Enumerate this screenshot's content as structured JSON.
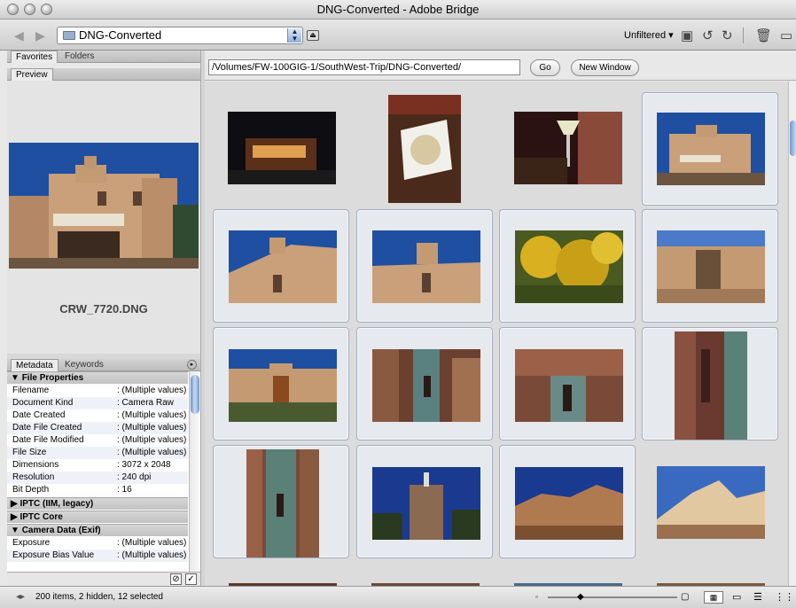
{
  "window": {
    "title": "DNG-Converted - Adobe Bridge"
  },
  "toolbar": {
    "folder": "DNG-Converted",
    "filter": "Unfiltered"
  },
  "left": {
    "top_tabs": [
      "Favorites",
      "Folders"
    ],
    "preview_tab": "Preview",
    "preview_filename": "CRW_7720.DNG",
    "meta_tabs": [
      "Metadata",
      "Keywords"
    ]
  },
  "metadata": {
    "file_properties": "File Properties",
    "rows": [
      {
        "k": "Filename",
        "v": ": (Multiple values)"
      },
      {
        "k": "Document Kind",
        "v": ": Camera Raw"
      },
      {
        "k": "Date Created",
        "v": ": (Multiple values)"
      },
      {
        "k": "Date File Created",
        "v": ": (Multiple values)"
      },
      {
        "k": "Date File Modified",
        "v": ": (Multiple values)"
      },
      {
        "k": "File Size",
        "v": ": (Multiple values)"
      },
      {
        "k": "Dimensions",
        "v": ": 3072 x 2048"
      },
      {
        "k": "Resolution",
        "v": ": 240 dpi"
      },
      {
        "k": "Bit Depth",
        "v": ": 16"
      }
    ],
    "iptc_legacy": "IPTC (IIM, legacy)",
    "iptc_core": "IPTC Core",
    "camera_data": "Camera Data (Exif)",
    "exif_rows": [
      {
        "k": "Exposure",
        "v": ": (Multiple values)"
      },
      {
        "k": "Exposure Bias Value",
        "v": ": (Multiple values)"
      }
    ]
  },
  "content": {
    "path": "/Volumes/FW-100GIG-1/SouthWest-Trip/DNG-Converted/",
    "go": "Go",
    "new_window": "New Window"
  },
  "status": {
    "text": "200 items, 2 hidden, 12 selected"
  },
  "colors": {
    "selection_border": "#a2aec0",
    "sky": "#1f4fa0",
    "adobe": "#c9a07a"
  }
}
